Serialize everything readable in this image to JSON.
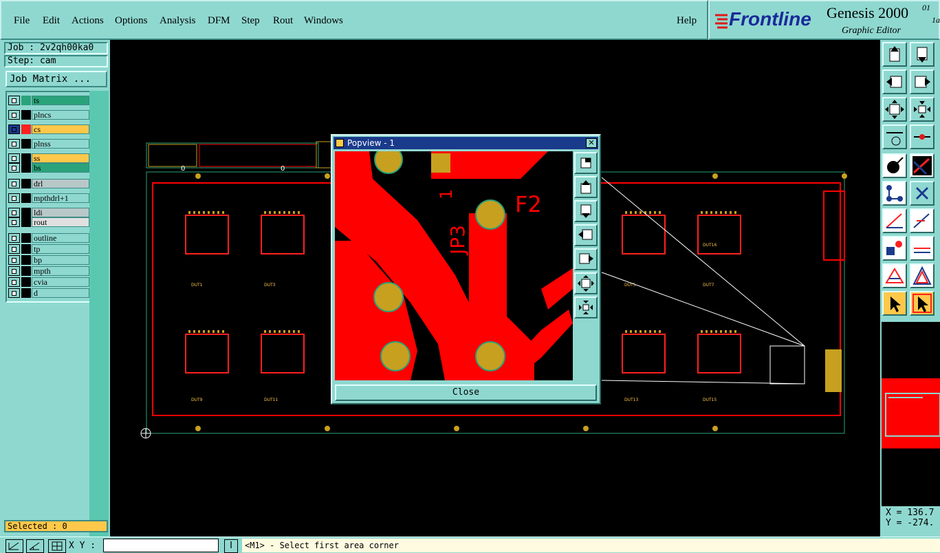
{
  "menu": {
    "items": [
      "File",
      "Edit",
      "Actions",
      "Options",
      "Analysis",
      "DFM",
      "Step",
      "Rout",
      "Windows"
    ],
    "help": "Help"
  },
  "brand": {
    "logo": "Frontline",
    "product": "Genesis 2000",
    "version_frag": "01",
    "version_frag2": "1a",
    "subtitle": "Graphic Editor"
  },
  "job": {
    "job_label": "Job : 2v2qh00ka0",
    "step_label": "Step: cam",
    "matrix_button": "Job Matrix ..."
  },
  "layers": [
    {
      "name": "ts",
      "color": "#2aa37a",
      "swatch": "#2aa37a"
    },
    {
      "name": "plncs",
      "color": "#8fd8d0",
      "swatch": ""
    },
    {
      "name": "cs",
      "color": "#ffc84a",
      "swatch": "#ff2020",
      "active": true
    },
    {
      "name": "plnss",
      "color": "#8fd8d0",
      "swatch": ""
    },
    {
      "name": "ss",
      "color": "#ffc84a",
      "swatch": ""
    },
    {
      "name": "bs",
      "color": "#2aa37a",
      "swatch": ""
    },
    {
      "name": "drl",
      "color": "#b8c8c8",
      "swatch": ""
    },
    {
      "name": "mpthdrl+1",
      "color": "#8fd8d0",
      "swatch": ""
    },
    {
      "name": "ldi",
      "color": "#b8c8c8",
      "swatch": ""
    },
    {
      "name": "rout",
      "color": "#e0e0e0",
      "swatch": ""
    },
    {
      "name": "outline",
      "color": "#8fd8d0",
      "swatch": ""
    },
    {
      "name": "tp",
      "color": "#8fd8d0",
      "swatch": ""
    },
    {
      "name": "bp",
      "color": "#8fd8d0",
      "swatch": ""
    },
    {
      "name": "mpth",
      "color": "#8fd8d0",
      "swatch": ""
    },
    {
      "name": "cvia",
      "color": "#8fd8d0",
      "swatch": ""
    },
    {
      "name": "d",
      "color": "#8fd8d0",
      "swatch": ""
    }
  ],
  "selected": "Selected : 0",
  "popview": {
    "title": "Popview - 1",
    "close": "Close",
    "label_jp3": "JP3",
    "label_1": "1",
    "label_f2": "F2"
  },
  "coords": {
    "x": "X = 136.7",
    "y": "Y = -274."
  },
  "status": {
    "xy_label": "X Y :",
    "xy_value": "",
    "message": "<M1> - Select first area corner"
  },
  "board": {
    "labels": [
      "DUT1",
      "DUT3",
      "DUT5",
      "DUT7",
      "DUT9",
      "DUT11",
      "DUT13",
      "DUT15",
      "DUT16"
    ],
    "zero": "0"
  },
  "colors": {
    "panel": "#8fd8d0",
    "copper": "#ff0000",
    "pad": "#c8a020",
    "highlight": "#ffc84a",
    "outline": "#2aa37a"
  }
}
